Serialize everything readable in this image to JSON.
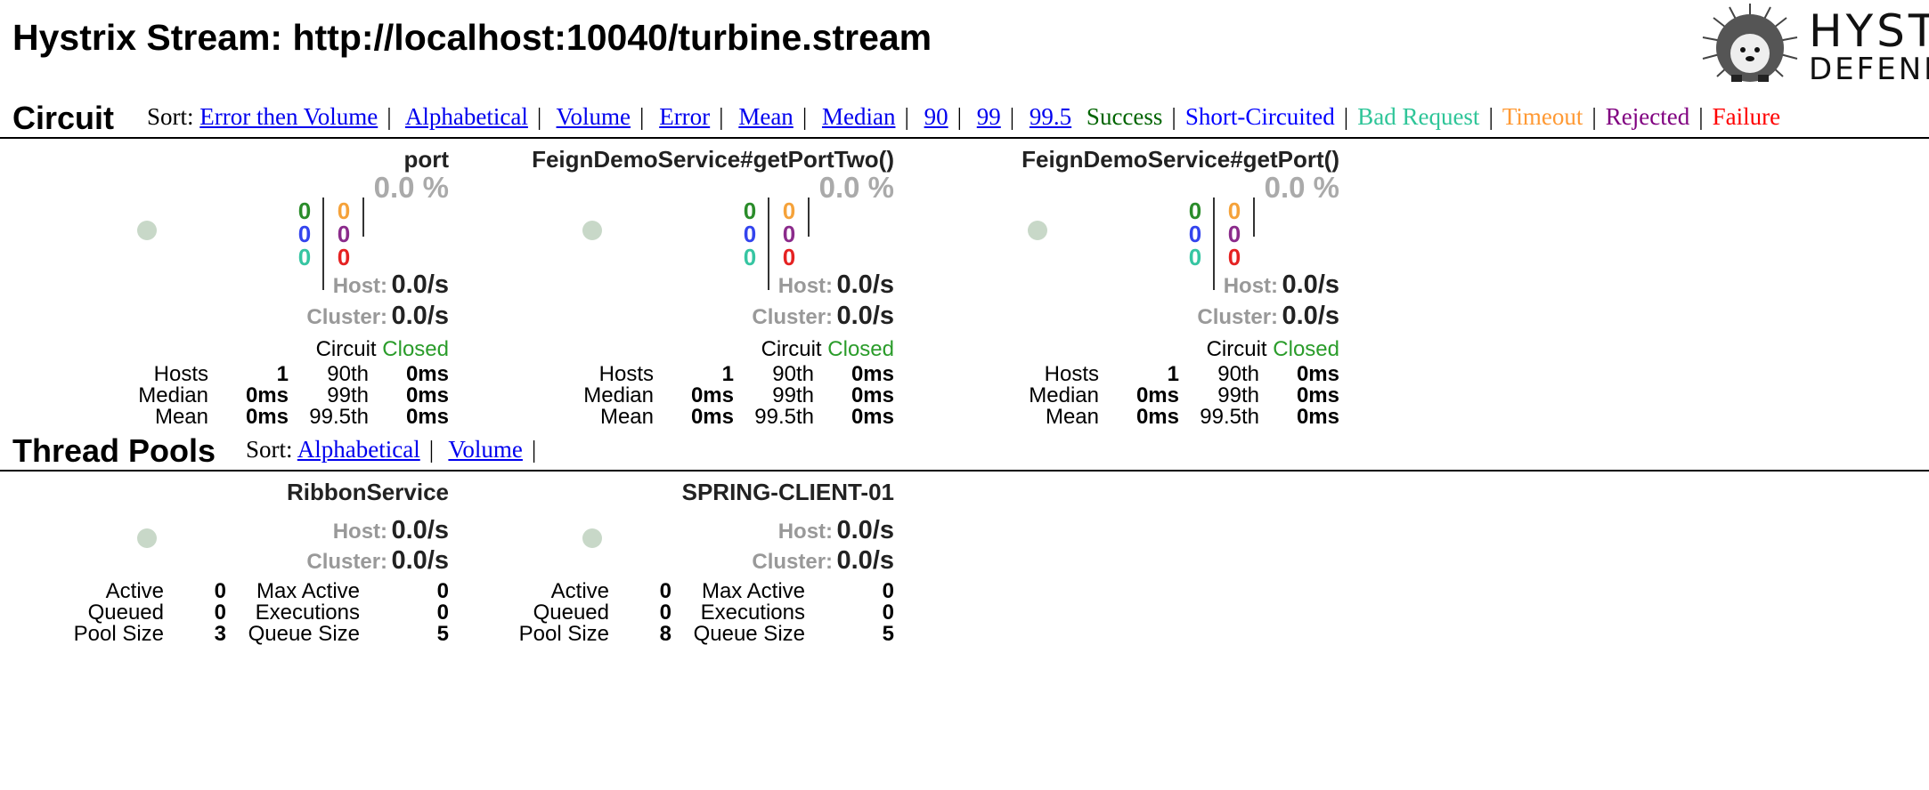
{
  "page_title": "Hystrix Stream: http://localhost:10040/turbine.stream",
  "logo": {
    "word": "HYSTRIX",
    "tagline": "DEFEND YOUR APP"
  },
  "circuit_section": {
    "title": "Circuit",
    "sort_label": "Sort:",
    "sort_links": [
      "Error then Volume",
      "Alphabetical",
      "Volume",
      "Error",
      "Mean",
      "Median",
      "90",
      "99",
      "99.5"
    ],
    "legend": [
      {
        "label": "Success",
        "color": "#006400"
      },
      {
        "label": "Short-Circuited",
        "color": "#0000ff"
      },
      {
        "label": "Bad Request",
        "color": "#2ec598"
      },
      {
        "label": "Timeout",
        "color": "#ff9933"
      },
      {
        "label": "Rejected",
        "color": "#800080"
      },
      {
        "label": "Failure",
        "color": "#ff0000"
      }
    ]
  },
  "colors": {
    "green": "#2a8c2a",
    "blue": "#3344ee",
    "teal": "#36c5a2",
    "orange": "#f5a23a",
    "purple": "#8b2b8b",
    "red": "#e52222",
    "closed": "#2a9c2a",
    "circle": "#c8d8c8"
  },
  "circuits": [
    {
      "name": "port",
      "counts": {
        "success": "0",
        "short_circuited": "0",
        "bad_request": "0",
        "timeout": "0",
        "rejected": "0",
        "failure": "0"
      },
      "error_rate": "0.0 %",
      "host_label": "Host:",
      "host_rate": "0.0/s",
      "cluster_label": "Cluster:",
      "cluster_rate": "0.0/s",
      "circuit_label": "Circuit",
      "circuit_status": "Closed",
      "stats": {
        "hosts_label": "Hosts",
        "hosts": "1",
        "median_label": "Median",
        "median": "0ms",
        "mean_label": "Mean",
        "mean": "0ms",
        "p90_label": "90th",
        "p90": "0ms",
        "p99_label": "99th",
        "p99": "0ms",
        "p995_label": "99.5th",
        "p995": "0ms"
      }
    },
    {
      "name": "FeignDemoService#getPortTwo()",
      "counts": {
        "success": "0",
        "short_circuited": "0",
        "bad_request": "0",
        "timeout": "0",
        "rejected": "0",
        "failure": "0"
      },
      "error_rate": "0.0 %",
      "host_label": "Host:",
      "host_rate": "0.0/s",
      "cluster_label": "Cluster:",
      "cluster_rate": "0.0/s",
      "circuit_label": "Circuit",
      "circuit_status": "Closed",
      "stats": {
        "hosts_label": "Hosts",
        "hosts": "1",
        "median_label": "Median",
        "median": "0ms",
        "mean_label": "Mean",
        "mean": "0ms",
        "p90_label": "90th",
        "p90": "0ms",
        "p99_label": "99th",
        "p99": "0ms",
        "p995_label": "99.5th",
        "p995": "0ms"
      }
    },
    {
      "name": "FeignDemoService#getPort()",
      "counts": {
        "success": "0",
        "short_circuited": "0",
        "bad_request": "0",
        "timeout": "0",
        "rejected": "0",
        "failure": "0"
      },
      "error_rate": "0.0 %",
      "host_label": "Host:",
      "host_rate": "0.0/s",
      "cluster_label": "Cluster:",
      "cluster_rate": "0.0/s",
      "circuit_label": "Circuit",
      "circuit_status": "Closed",
      "stats": {
        "hosts_label": "Hosts",
        "hosts": "1",
        "median_label": "Median",
        "median": "0ms",
        "mean_label": "Mean",
        "mean": "0ms",
        "p90_label": "90th",
        "p90": "0ms",
        "p99_label": "99th",
        "p99": "0ms",
        "p995_label": "99.5th",
        "p995": "0ms"
      }
    }
  ],
  "threadpool_section": {
    "title": "Thread Pools",
    "sort_label": "Sort:",
    "sort_links": [
      "Alphabetical",
      "Volume"
    ]
  },
  "thread_pools": [
    {
      "name": "RibbonService",
      "host_label": "Host:",
      "host_rate": "0.0/s",
      "cluster_label": "Cluster:",
      "cluster_rate": "0.0/s",
      "stats": {
        "active_label": "Active",
        "active": "0",
        "queued_label": "Queued",
        "queued": "0",
        "pool_size_label": "Pool Size",
        "pool_size": "3",
        "max_active_label": "Max Active",
        "max_active": "0",
        "executions_label": "Executions",
        "executions": "0",
        "queue_size_label": "Queue Size",
        "queue_size": "5"
      }
    },
    {
      "name": "SPRING-CLIENT-01",
      "host_label": "Host:",
      "host_rate": "0.0/s",
      "cluster_label": "Cluster:",
      "cluster_rate": "0.0/s",
      "stats": {
        "active_label": "Active",
        "active": "0",
        "queued_label": "Queued",
        "queued": "0",
        "pool_size_label": "Pool Size",
        "pool_size": "8",
        "max_active_label": "Max Active",
        "max_active": "0",
        "executions_label": "Executions",
        "executions": "0",
        "queue_size_label": "Queue Size",
        "queue_size": "5"
      }
    }
  ]
}
